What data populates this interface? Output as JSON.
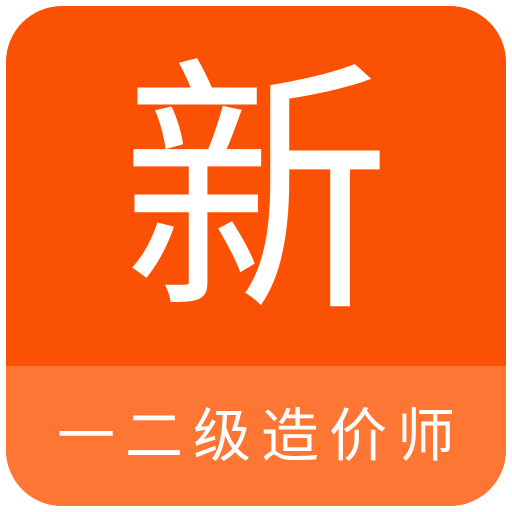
{
  "icon": {
    "glyph": "新",
    "subtitle": "一二级造价师",
    "colors": {
      "background": "#fb5104",
      "band": "#fe7633",
      "text": "#ffffff"
    }
  }
}
